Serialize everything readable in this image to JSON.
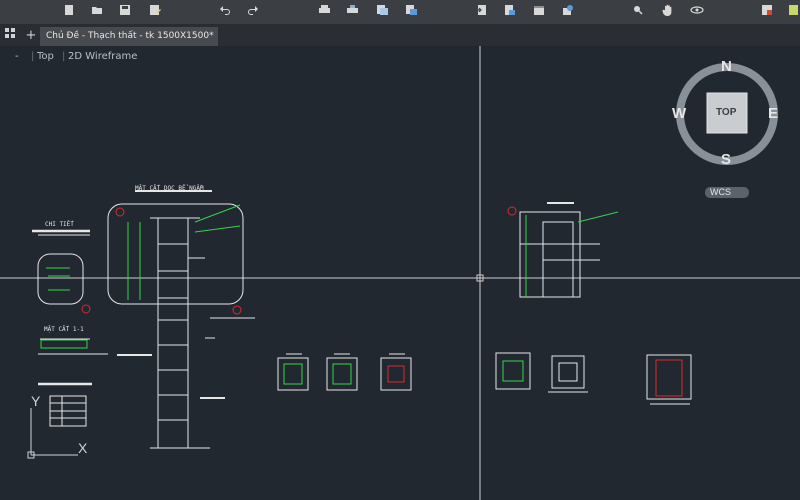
{
  "toolbar": {
    "left_icons": [
      "new-file-icon",
      "open-folder-icon",
      "save-icon",
      "save-as-icon"
    ],
    "history_icons": [
      "undo-icon",
      "redo-icon"
    ],
    "print_icons": [
      "print-icon",
      "plot-icon",
      "publish-icon",
      "batch-plot-icon"
    ],
    "middle_icons": [
      "import-icon",
      "export-icon",
      "sheet-icon",
      "render-icon"
    ],
    "right_icons": [
      "zoom-icon",
      "pan-hand-icon",
      "orbit-icon"
    ],
    "far_right_icons": [
      "app-menu-icon",
      "layout-icon"
    ]
  },
  "tabs": {
    "document_tab_label": "Chủ Đề - Thạch thất - tk 1500X1500*",
    "new_tab_symbol": "+"
  },
  "viewport": {
    "view_menu": "Top",
    "visual_style": "2D Wireframe",
    "minus_symbol": "-"
  },
  "viewcube": {
    "north": "N",
    "south": "S",
    "east": "E",
    "west": "W",
    "face": "TOP",
    "ucs_label": "WCS"
  },
  "ucs_icon": {
    "x_label": "X",
    "y_label": "Y"
  },
  "drawing": {
    "title_section_1": "MẶT CẮT DỌC BỂ NGẦM",
    "title_section_2": "MẶT CẮT 1-1",
    "title_plan": "CHI TIẾT"
  },
  "colors": {
    "background": "#212830",
    "lines": "#e6e6e6",
    "annotation_green": "#39d24a",
    "marker_red": "#d92b2b",
    "crosshair": "#e0e0e0"
  }
}
